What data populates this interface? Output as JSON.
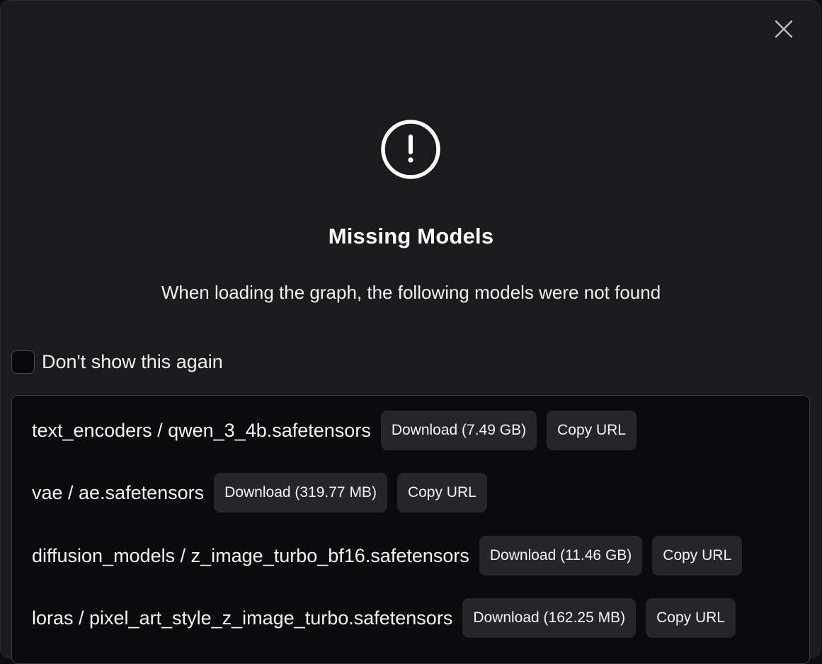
{
  "dialog": {
    "title": "Missing Models",
    "subtitle": "When loading the graph, the following models were not found",
    "dont_show_label": "Don't show this again",
    "dont_show_checked": false,
    "icons": {
      "close": "close-icon",
      "warning": "exclamation-circle-icon"
    }
  },
  "models": [
    {
      "name": "text_encoders / qwen_3_4b.safetensors",
      "download_label": "Download (7.49 GB)",
      "copy_label": "Copy URL"
    },
    {
      "name": "vae / ae.safetensors",
      "download_label": "Download (319.77 MB)",
      "copy_label": "Copy URL"
    },
    {
      "name": "diffusion_models / z_image_turbo_bf16.safetensors",
      "download_label": "Download (11.46 GB)",
      "copy_label": "Copy URL"
    },
    {
      "name": "loras / pixel_art_style_z_image_turbo.safetensors",
      "download_label": "Download (162.25 MB)",
      "copy_label": "Copy URL"
    }
  ]
}
